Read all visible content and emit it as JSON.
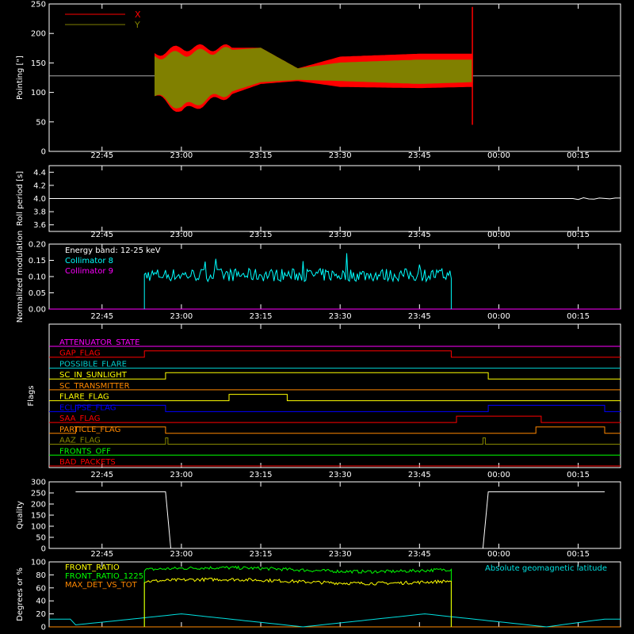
{
  "time_ticks": [
    "22:45",
    "23:00",
    "23:15",
    "23:30",
    "23:45",
    "00:00",
    "00:15"
  ],
  "chart_data": [
    {
      "id": "pointing",
      "type": "line",
      "ylabel": "Pointing [\"]",
      "ylim": [
        0,
        250
      ],
      "yticks": [
        "0",
        "50",
        "100",
        "150",
        "200",
        "250"
      ],
      "legend_placement": "top-left",
      "series": [
        {
          "name": "X",
          "color": "#ff0000",
          "baseline": 128,
          "envelope_x": [
            "22:55",
            "23:00",
            "23:15",
            "23:22",
            "23:30",
            "23:45",
            "23:55"
          ],
          "upper": [
            165,
            175,
            175,
            140,
            160,
            165,
            165
          ],
          "lower": [
            95,
            68,
            115,
            120,
            110,
            108,
            110
          ]
        },
        {
          "name": "Y",
          "color": "#808000",
          "baseline": 128,
          "envelope_x": [
            "22:55",
            "23:00",
            "23:15",
            "23:22",
            "23:30",
            "23:45",
            "23:55"
          ],
          "upper": [
            160,
            165,
            175,
            140,
            150,
            155,
            155
          ],
          "lower": [
            95,
            75,
            118,
            122,
            120,
            115,
            118
          ]
        }
      ]
    },
    {
      "id": "roll",
      "type": "line",
      "ylabel": "Roll period [s]",
      "ylim": [
        3.5,
        4.5
      ],
      "yticks": [
        "3.6",
        "3.8",
        "4.0",
        "4.2",
        "4.4"
      ],
      "series": [
        {
          "name": "",
          "color": "#ffffff",
          "x": [
            "22:40",
            "00:20"
          ],
          "y": [
            4.0,
            4.0
          ]
        }
      ]
    },
    {
      "id": "modulation",
      "type": "line",
      "ylabel": "Normalized modulation",
      "ylim": [
        0,
        0.2
      ],
      "yticks": [
        "0.00",
        "0.05",
        "0.10",
        "0.15",
        "0.20"
      ],
      "annotation": "Energy band: 12-25 keV",
      "series": [
        {
          "name": "Collimator 8",
          "color": "#00ffff",
          "x_start": "22:53",
          "x_end": "23:51",
          "mean": 0.105
        },
        {
          "name": "Collimator 9",
          "color": "#ff00ff",
          "x": [
            "22:40",
            "00:20"
          ],
          "y": [
            0,
            0
          ]
        }
      ]
    },
    {
      "id": "flags",
      "type": "line",
      "ylabel": "Flags",
      "series": [
        {
          "name": "ATTENUATOR_STATE",
          "color": "#ff00ff",
          "steps": []
        },
        {
          "name": "GAP_FLAG",
          "color": "#ff0000",
          "steps": [
            [
              "22:53",
              "23:51",
              1
            ]
          ]
        },
        {
          "name": "POSSIBLE_FLARE",
          "color": "#00cccc",
          "steps": []
        },
        {
          "name": "SC_IN_SUNLIGHT",
          "color": "#ffff00",
          "steps": [
            [
              "22:57",
              "23:58",
              1
            ]
          ]
        },
        {
          "name": "SC_TRANSMITTER",
          "color": "#ff8800",
          "steps": []
        },
        {
          "name": "FLARE_FLAG",
          "color": "#ffff00",
          "steps": [
            [
              "23:09",
              "23:20",
              1
            ]
          ]
        },
        {
          "name": "ECLIPSE_FLAG",
          "color": "#0000ff",
          "steps": [
            [
              "22:40",
              "22:57",
              1
            ],
            [
              "23:58",
              "00:20",
              1
            ]
          ]
        },
        {
          "name": "SAA_FLAG",
          "color": "#ff0000",
          "steps": [
            [
              "23:52",
              "00:08",
              1
            ]
          ]
        },
        {
          "name": "PARTICLE_FLAG",
          "color": "#ff8800",
          "steps": [
            [
              "22:40",
              "22:57",
              1
            ],
            [
              "00:07",
              "00:20",
              1
            ]
          ]
        },
        {
          "name": "AAZ_FLAG",
          "color": "#888800",
          "steps": [
            [
              "22:57",
              "22:57",
              1
            ],
            [
              "23:57",
              "23:57",
              1
            ]
          ]
        },
        {
          "name": "FRONTS_OFF",
          "color": "#00ff00",
          "steps": []
        },
        {
          "name": "BAD_PACKETS",
          "color": "#ff0000",
          "steps": []
        }
      ]
    },
    {
      "id": "quality",
      "type": "line",
      "ylabel": "Quality",
      "ylim": [
        0,
        300
      ],
      "yticks": [
        "0",
        "50",
        "100",
        "150",
        "200",
        "250",
        "300"
      ],
      "series": [
        {
          "name": "",
          "color": "#ffffff",
          "x": [
            "22:40",
            "22:57",
            "22:58",
            "23:57",
            "23:58",
            "00:20"
          ],
          "y": [
            255,
            255,
            0,
            0,
            255,
            255
          ]
        }
      ]
    },
    {
      "id": "ratios",
      "type": "line",
      "ylabel": "Degrees or %",
      "ylim": [
        0,
        100
      ],
      "yticks": [
        "0",
        "20",
        "40",
        "60",
        "80",
        "100"
      ],
      "annotation": "Absolute geomagnetic latitude",
      "series": [
        {
          "name": "FRONT_RATIO",
          "color": "#ffff00",
          "x_start": "22:53",
          "x_end": "23:51",
          "mean": 70
        },
        {
          "name": "FRONT_RATIO_1225",
          "color": "#00ff00",
          "x_start": "22:53",
          "x_end": "23:51",
          "mean": 88
        },
        {
          "name": "MAX_DET_VS_TOT",
          "color": "#ff8800",
          "x": [
            "22:40",
            "00:20"
          ],
          "y": [
            0,
            0
          ]
        },
        {
          "name": "Absolute geomagnetic latitude",
          "color": "#00e0e0",
          "x": [
            "22:40",
            "23:00",
            "23:23",
            "23:46",
            "00:09",
            "00:20"
          ],
          "y": [
            3,
            20,
            0,
            20,
            0,
            12
          ]
        }
      ]
    }
  ]
}
